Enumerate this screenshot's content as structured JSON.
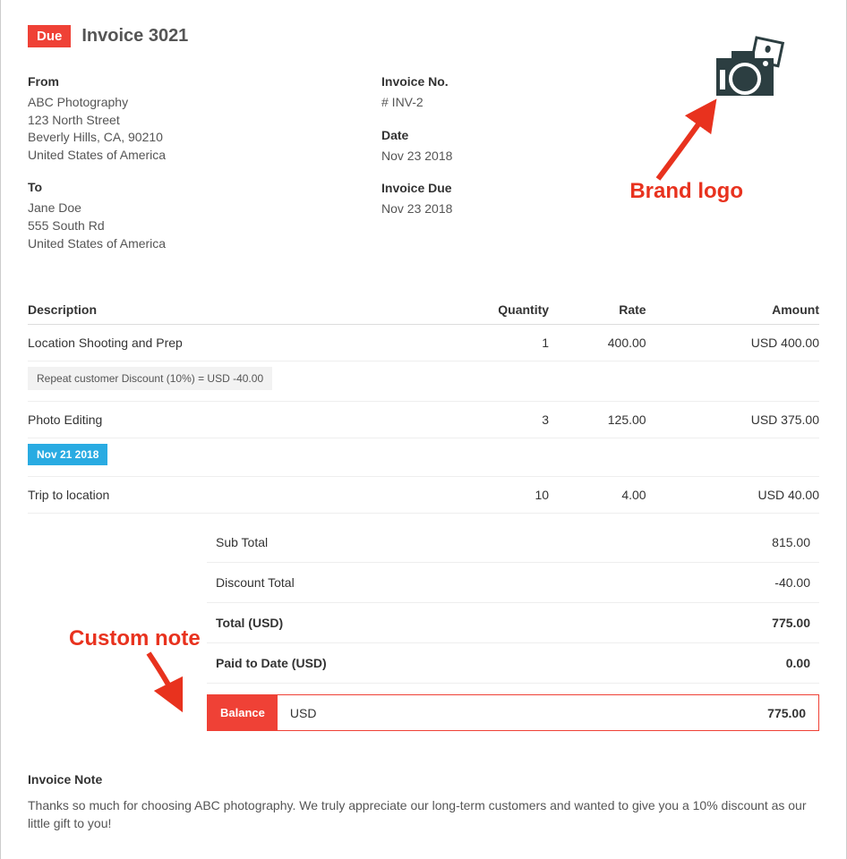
{
  "status_badge": "Due",
  "invoice_title": "Invoice 3021",
  "from": {
    "label": "From",
    "name": "ABC Photography",
    "street": "123 North Street",
    "city": "Beverly Hills, CA, 90210",
    "country": "United States of America"
  },
  "to": {
    "label": "To",
    "name": "Jane Doe",
    "street": "555 South Rd",
    "country": "United States of America"
  },
  "meta": {
    "invoice_no_label": "Invoice No.",
    "invoice_no": "# INV-2",
    "date_label": "Date",
    "date": "Nov 23 2018",
    "due_label": "Invoice Due",
    "due": "Nov 23 2018"
  },
  "columns": {
    "description": "Description",
    "quantity": "Quantity",
    "rate": "Rate",
    "amount": "Amount"
  },
  "items": [
    {
      "description": "Location Shooting and Prep",
      "quantity": "1",
      "rate": "400.00",
      "amount": "USD 400.00",
      "discount_note": "Repeat customer Discount (10%) = USD -40.00"
    },
    {
      "description": "Photo Editing",
      "quantity": "3",
      "rate": "125.00",
      "amount": "USD 375.00",
      "date_badge": "Nov 21 2018"
    },
    {
      "description": "Trip to location",
      "quantity": "10",
      "rate": "4.00",
      "amount": "USD 40.00"
    }
  ],
  "totals": {
    "subtotal_label": "Sub Total",
    "subtotal": "815.00",
    "discount_label": "Discount Total",
    "discount": "-40.00",
    "total_label": "Total (USD)",
    "total": "775.00",
    "paid_label": "Paid to Date (USD)",
    "paid": "0.00",
    "balance_label": "Balance",
    "balance_currency": "USD",
    "balance": "775.00"
  },
  "note": {
    "title": "Invoice Note",
    "body": "Thanks so much for choosing ABC photography. We truly appreciate our long-term customers and wanted to give you a 10% discount as our little gift to you!"
  },
  "annotations": {
    "logo": "Brand logo",
    "note": "Custom note"
  }
}
